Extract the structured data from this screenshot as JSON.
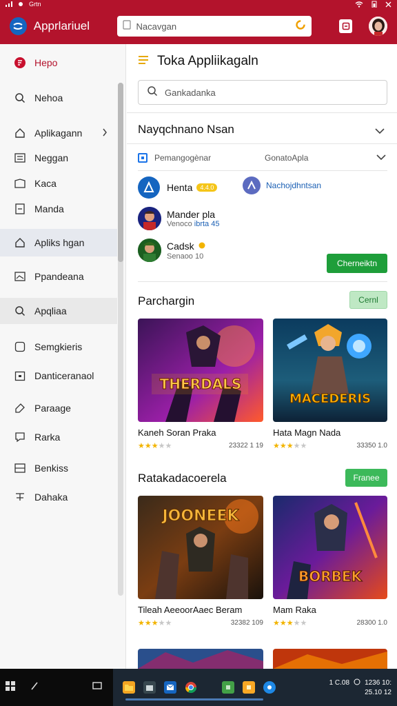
{
  "status_bar": {
    "left_text": "Grtn"
  },
  "header": {
    "app_title": "Apprlariuel",
    "search_placeholder": "Nacavgan"
  },
  "sidebar": {
    "items": [
      {
        "label": "Hepo",
        "icon": "home-icon"
      },
      {
        "label": "Nehoa",
        "icon": "search-icon"
      },
      {
        "label": "Aplikagann",
        "icon": "home-outline-icon"
      },
      {
        "label": "Neggan",
        "icon": "list-icon"
      },
      {
        "label": "Kaca",
        "icon": "book-icon"
      },
      {
        "label": "Manda",
        "icon": "document-icon"
      },
      {
        "label": "Apliks hgan",
        "icon": "home-outline-icon"
      },
      {
        "label": "Ppandeana",
        "icon": "image-icon"
      },
      {
        "label": "Apqliaa",
        "icon": "search-icon"
      },
      {
        "label": "Semgkieris",
        "icon": "square-icon"
      },
      {
        "label": "Danticeranaol",
        "icon": "calendar-icon"
      },
      {
        "label": "Paraage",
        "icon": "tag-icon"
      },
      {
        "label": "Rarka",
        "icon": "chat-icon"
      },
      {
        "label": "Benkiss",
        "icon": "grid-icon"
      },
      {
        "label": "Dahaka",
        "icon": "text-icon"
      }
    ]
  },
  "main": {
    "title": "Toka Appliikagaln",
    "search_placeholder": "Gankadanka",
    "section1_title": "Nayqchnano Nsan",
    "filter_option": "Pemangogènar",
    "filter_sort": "GonatoApla",
    "apps": [
      {
        "name": "Henta",
        "rating": "4.4.0",
        "developer": "Nachojdhntsan"
      },
      {
        "name": "Mander pla",
        "sub_prefix": "Venoco ",
        "sub_blue": "ibrta 45"
      },
      {
        "name": "Cadsk",
        "sub": "Senaoo 10"
      }
    ],
    "install_button": "Cherneiktn",
    "section2_title": "Parchargin",
    "section2_button": "Cernl",
    "section3_title": "Ratakadacoerela",
    "section3_button": "Franee",
    "cards": [
      {
        "title": "Kaneh Soran Praka",
        "count": "23322 1 19",
        "stars": 3,
        "art": "THERDALS"
      },
      {
        "title": "Hata Magn Nada",
        "count": "33350 1.0",
        "stars": 3,
        "art": "MACEDERIS"
      },
      {
        "title": "Tileah AeeoorAaec Beram",
        "count": "32382 109",
        "stars": 3,
        "art": "JOONEEK"
      },
      {
        "title": "Mam Raka",
        "count": "28300 1.0",
        "stars": 3,
        "art": "BORBEK"
      }
    ]
  },
  "taskbar": {
    "time": "1 C.08",
    "date": "1236 10:",
    "date2": "25.10 12"
  },
  "colors": {
    "brand_red": "#b3132c",
    "accent_green": "#1e9e3a",
    "link_blue": "#1a5fb4",
    "star_gold": "#f2b400"
  }
}
